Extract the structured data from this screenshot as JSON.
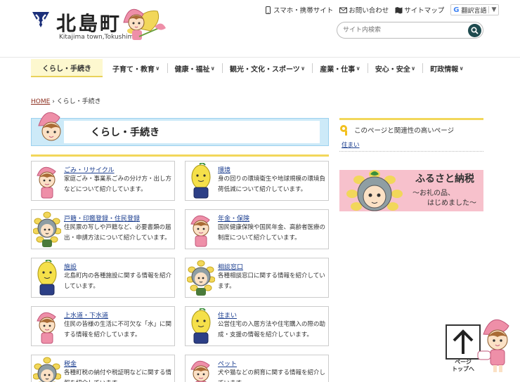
{
  "header": {
    "logo_title": "北島町",
    "logo_sub": "Kitajima town,Tokushima",
    "util_links": [
      {
        "label": "スマホ・携帯サイト",
        "icon": "smartphone-icon"
      },
      {
        "label": "お問い合わせ",
        "icon": "mail-icon"
      },
      {
        "label": "サイトマップ",
        "icon": "map-icon"
      }
    ],
    "translate_label": "翻訳言語",
    "translate_arrow": "▼",
    "search_placeholder": "サイト内検索"
  },
  "nav": {
    "items": [
      {
        "label": "くらし・手続き",
        "chevron": ""
      },
      {
        "label": "子育て・教育",
        "chevron": "∨"
      },
      {
        "label": "健康・福祉",
        "chevron": "∨"
      },
      {
        "label": "観光・文化・スポーツ",
        "chevron": "∨"
      },
      {
        "label": "産業・仕事",
        "chevron": "∨"
      },
      {
        "label": "安心・安全",
        "chevron": "∨"
      },
      {
        "label": "町政情報",
        "chevron": "∨"
      }
    ]
  },
  "breadcrumb": {
    "home": "HOME",
    "separator": "›",
    "current": "くらし・手続き"
  },
  "page_title": "くらし・手続き",
  "cards": [
    {
      "title": "ごみ・リサイクル",
      "desc": "家庭ごみ・事業系ごみの分け方・出し方などについて紹介しています。",
      "char": "pink"
    },
    {
      "title": "環境",
      "desc": "身の回りの環境衛生や地球規模の環境負荷低減について紹介しています。",
      "char": "lemon"
    },
    {
      "title": "戸籍・印鑑登録・住民登録",
      "desc": "住民票の写しや戸籍など、必要書類の届出・申請方法について紹介しています。",
      "char": "sunflower"
    },
    {
      "title": "年金・保険",
      "desc": "国民健康保険や国民年金、高齢者医療の制度について紹介しています。",
      "char": "pink"
    },
    {
      "title": "施設",
      "desc": "北島町内の各種施設に関する情報を紹介しています。",
      "char": "lemon"
    },
    {
      "title": "相談窓口",
      "desc": "各種相談窓口に関する情報を紹介しています。",
      "char": "sunflower"
    },
    {
      "title": "上水道・下水道",
      "desc": "住民の皆様の生活に不可欠な「水」に関する情報を紹介しています。",
      "char": "pink"
    },
    {
      "title": "住まい",
      "desc": "公営住宅の入居方法や住宅購入の際の助成・支援の情報を紹介しています。",
      "char": "lemon"
    },
    {
      "title": "税金",
      "desc": "各種町税の納付や税証明などに関する情報を紹介しています。",
      "char": "sunflower"
    },
    {
      "title": "ペット",
      "desc": "犬や猫などの飼育に関する情報を紹介しています。",
      "char": "pink"
    }
  ],
  "sidebar": {
    "related_heading": "このページと関連性の高いページ",
    "related_link": "住まい",
    "banner_title": "ふるさと納税",
    "banner_sub1": "～お礼の品、",
    "banner_sub2": "はじめました～"
  },
  "pagetop": {
    "line1": "ページ",
    "line2": "トップへ"
  },
  "colors": {
    "nav_active_bg": "#fdf8cf",
    "accent_yellow": "#f2d75a",
    "title_blue": "#cdeaf8",
    "link_blue": "#1a3d8f",
    "banner_pink": "#f7c1cc",
    "search_btn": "#1e4b4f"
  }
}
